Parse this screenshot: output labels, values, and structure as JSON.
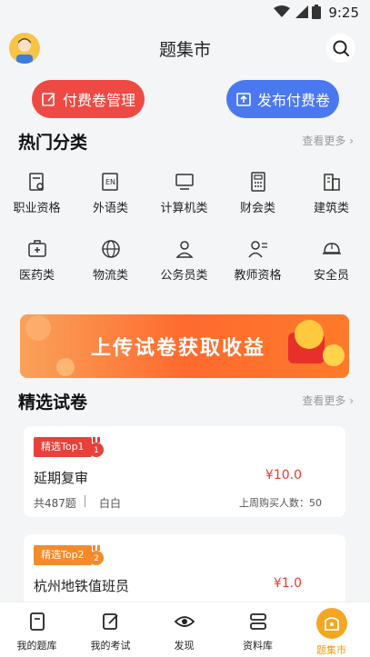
{
  "status": {
    "time": "9:25"
  },
  "header": {
    "title": "题集市"
  },
  "actions": {
    "manage_label": "付费卷管理",
    "publish_label": "发布付费卷"
  },
  "hot": {
    "title": "热门分类",
    "more": "查看更多",
    "categories": [
      {
        "label": "职业资格",
        "icon": "certificate-icon"
      },
      {
        "label": "外语类",
        "icon": "en-book-icon"
      },
      {
        "label": "计算机类",
        "icon": "monitor-icon"
      },
      {
        "label": "财会类",
        "icon": "calculator-icon"
      },
      {
        "label": "建筑类",
        "icon": "building-icon"
      },
      {
        "label": "医药类",
        "icon": "medicine-icon"
      },
      {
        "label": "物流类",
        "icon": "globe-icon"
      },
      {
        "label": "公务员类",
        "icon": "person-badge-icon"
      },
      {
        "label": "教师资格",
        "icon": "teacher-icon"
      },
      {
        "label": "安全员",
        "icon": "helmet-icon"
      }
    ]
  },
  "banner": {
    "text": "上传试卷获取收益"
  },
  "featured": {
    "title": "精选试卷",
    "more": "查看更多",
    "papers": [
      {
        "tag": "精选Top1",
        "rank": "1",
        "name": "延期复审",
        "price": "¥10.0",
        "count": "共487题",
        "author": "白白",
        "buyers": "上周购买人数：50"
      },
      {
        "tag": "精选Top2",
        "rank": "2",
        "name": "杭州地铁值班员",
        "price": "¥1.0"
      }
    ]
  },
  "tabs": [
    {
      "label": "我的题库",
      "icon": "book-icon"
    },
    {
      "label": "我的考试",
      "icon": "edit-icon"
    },
    {
      "label": "发现",
      "icon": "eye-icon"
    },
    {
      "label": "资料库",
      "icon": "archive-icon"
    },
    {
      "label": "题集市",
      "icon": "market-icon",
      "active": true
    }
  ],
  "colors": {
    "red": "#ee4a43",
    "blue": "#4a78f0",
    "price": "#ee3a2e",
    "active_tab": "#f59a0b"
  }
}
